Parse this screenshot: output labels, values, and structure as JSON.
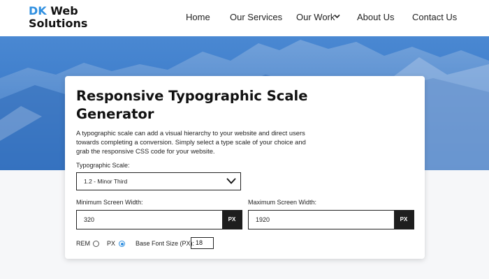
{
  "brand": {
    "dk": "DK",
    "web": "Web",
    "solutions": "Solutions",
    "accent": "#2f8fe0"
  },
  "nav": {
    "items": [
      {
        "label": "Home"
      },
      {
        "label": "Our Services"
      },
      {
        "label": "Our Work"
      },
      {
        "label": "About Us"
      },
      {
        "label": "Contact Us"
      }
    ]
  },
  "card": {
    "title_line1": "Responsive Typographic Scale",
    "title_line2": "Generator",
    "description": "A typographic scale can add a visual hierarchy to your website and direct users towards completing a conversion. Simply select a type scale of your choice and grab the responsive CSS code for your website.",
    "scale_label": "Typographic Scale:",
    "scale_value": "1.2 - Minor Third",
    "min_label": "Minimum Screen Width:",
    "min_value": "320",
    "min_unit": "PX",
    "max_label": "Maximum Screen Width:",
    "max_value": "1920",
    "max_unit": "PX",
    "unit_rem": "REM",
    "unit_px": "PX",
    "unit_selected": "PX",
    "base_label": "Base Font Size (PX):",
    "base_value": "18"
  },
  "colors": {
    "hero_top": "#3f80cf",
    "hero_bottom": "#2c6fc2",
    "dark": "#1e1e1e"
  }
}
